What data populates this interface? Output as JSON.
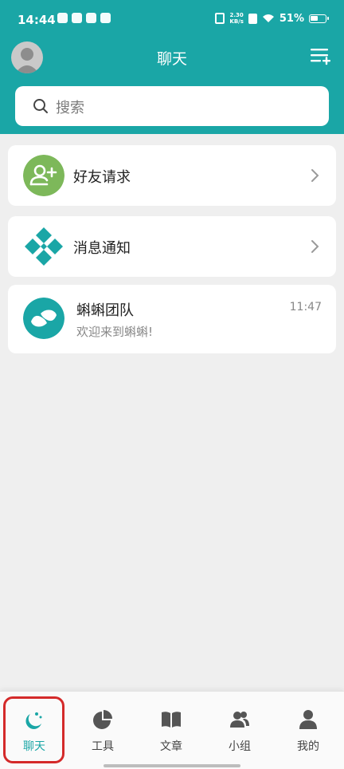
{
  "status_bar": {
    "time": "14:44",
    "net_speed_value": "2.30",
    "net_speed_unit": "KB/s",
    "battery": "51%",
    "battery_level": 0.51
  },
  "header": {
    "title": "聊天",
    "avatar_icon": "default-avatar-icon",
    "menu_icon": "menu-add-icon",
    "accent_color": "#1aa6a6"
  },
  "search": {
    "placeholder": "搜索"
  },
  "list": {
    "friend_request": {
      "label": "好友请求",
      "icon": "add-friend-icon",
      "color": "#7db85a"
    },
    "notifications": {
      "label": "消息通知",
      "icon": "notification-diamond-icon",
      "color": "#1aa6a6"
    },
    "conversations": [
      {
        "name": "蝌蝌团队",
        "last_message": "欢迎来到蝌蝌!",
        "time": "11:47",
        "icon": "team-logo-icon"
      }
    ]
  },
  "tabbar": {
    "tabs": [
      {
        "label": "聊天",
        "icon": "chat-icon",
        "active": true
      },
      {
        "label": "工具",
        "icon": "pie-chart-icon",
        "active": false
      },
      {
        "label": "文章",
        "icon": "book-icon",
        "active": false
      },
      {
        "label": "小组",
        "icon": "group-icon",
        "active": false
      },
      {
        "label": "我的",
        "icon": "person-icon",
        "active": false
      }
    ]
  }
}
